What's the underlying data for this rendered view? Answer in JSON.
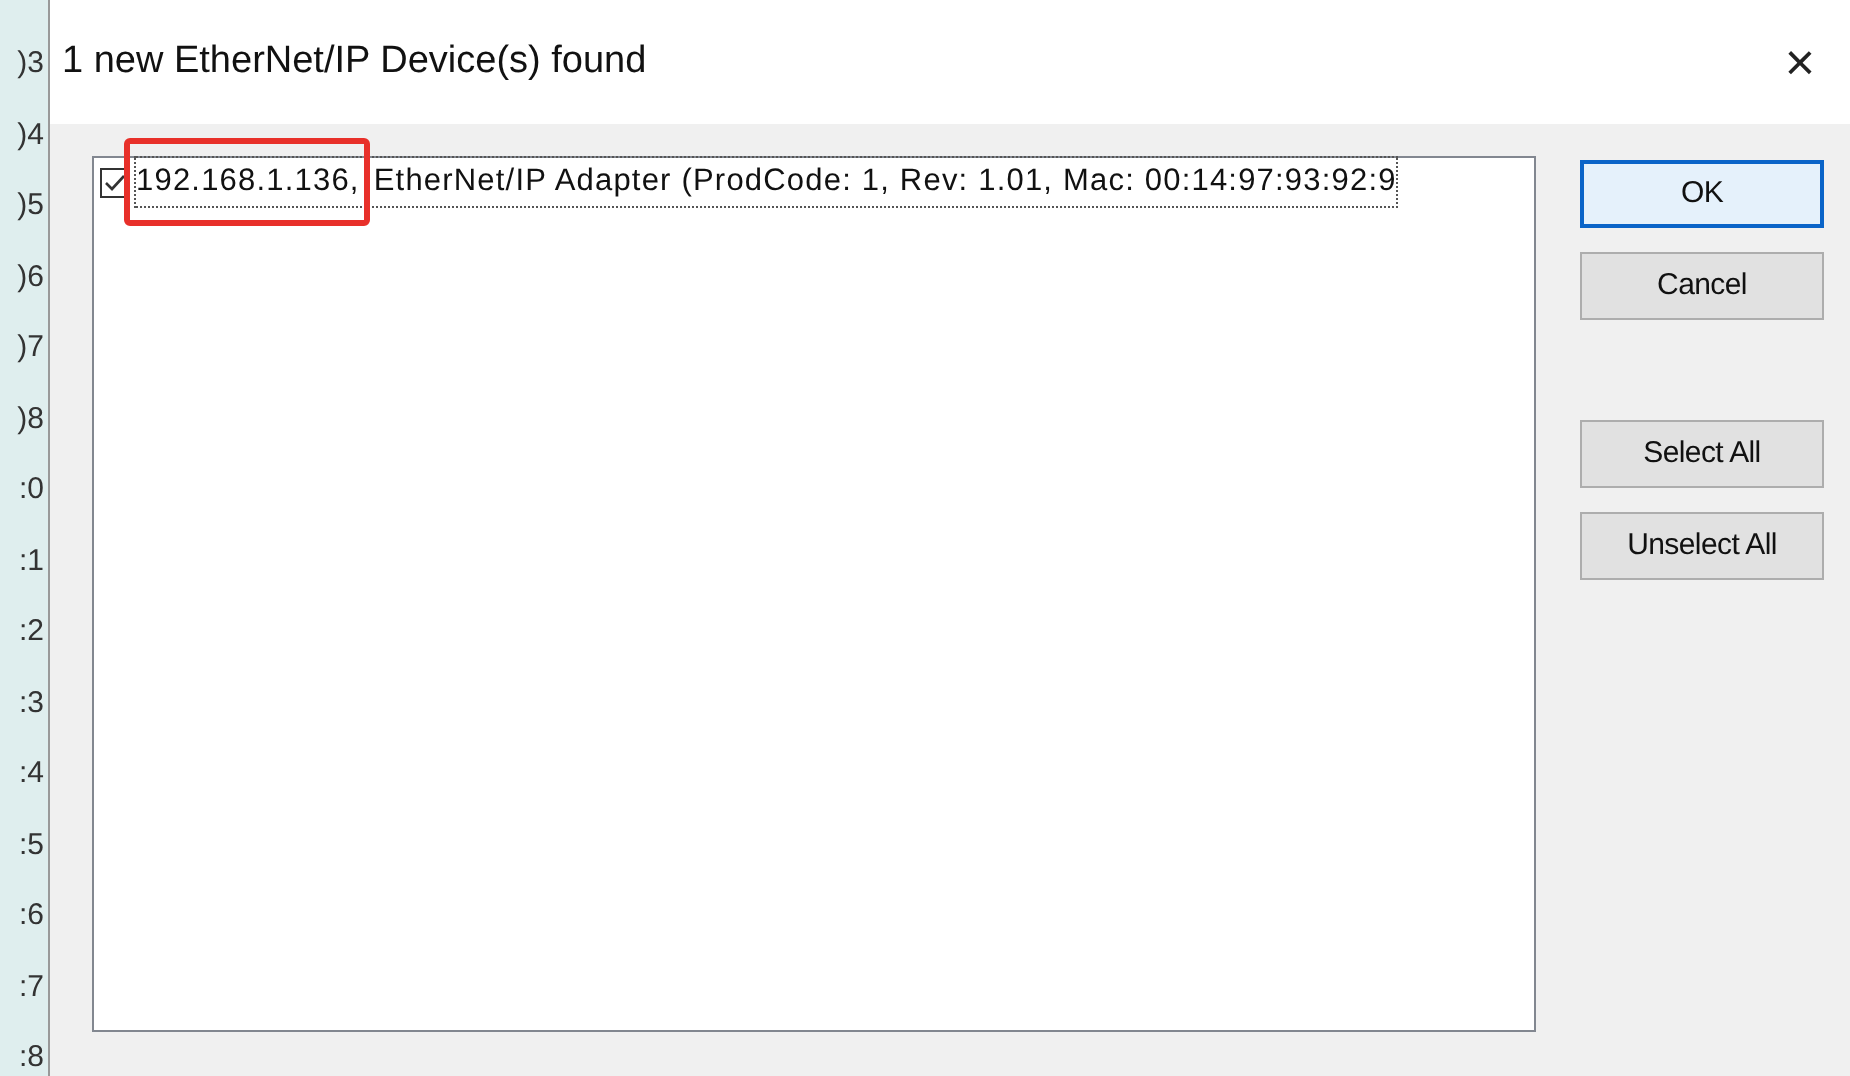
{
  "background_fragments": [
    ")3",
    ")4",
    ")5",
    ")6",
    ")7",
    ")8",
    ":0",
    ":1",
    ":2",
    ":3",
    ":4",
    ":5",
    ":6",
    ":7",
    ":8"
  ],
  "window": {
    "title": "1 new EtherNet/IP Device(s) found",
    "close": "×"
  },
  "devices": [
    {
      "address": "192.168.1.136,",
      "description": "EtherNet/IP Adapter (ProdCode: 1, Rev: 1.01, Mac: 00:14:97:93:92:9",
      "checked": true,
      "focused": true,
      "highlighted": true
    }
  ],
  "button_groups": [
    [
      {
        "label": "OK",
        "default": true
      },
      {
        "label": "Cancel",
        "default": false
      }
    ],
    [
      {
        "label": "Select All",
        "default": false
      },
      {
        "label": "Unselect All",
        "default": false
      }
    ]
  ]
}
